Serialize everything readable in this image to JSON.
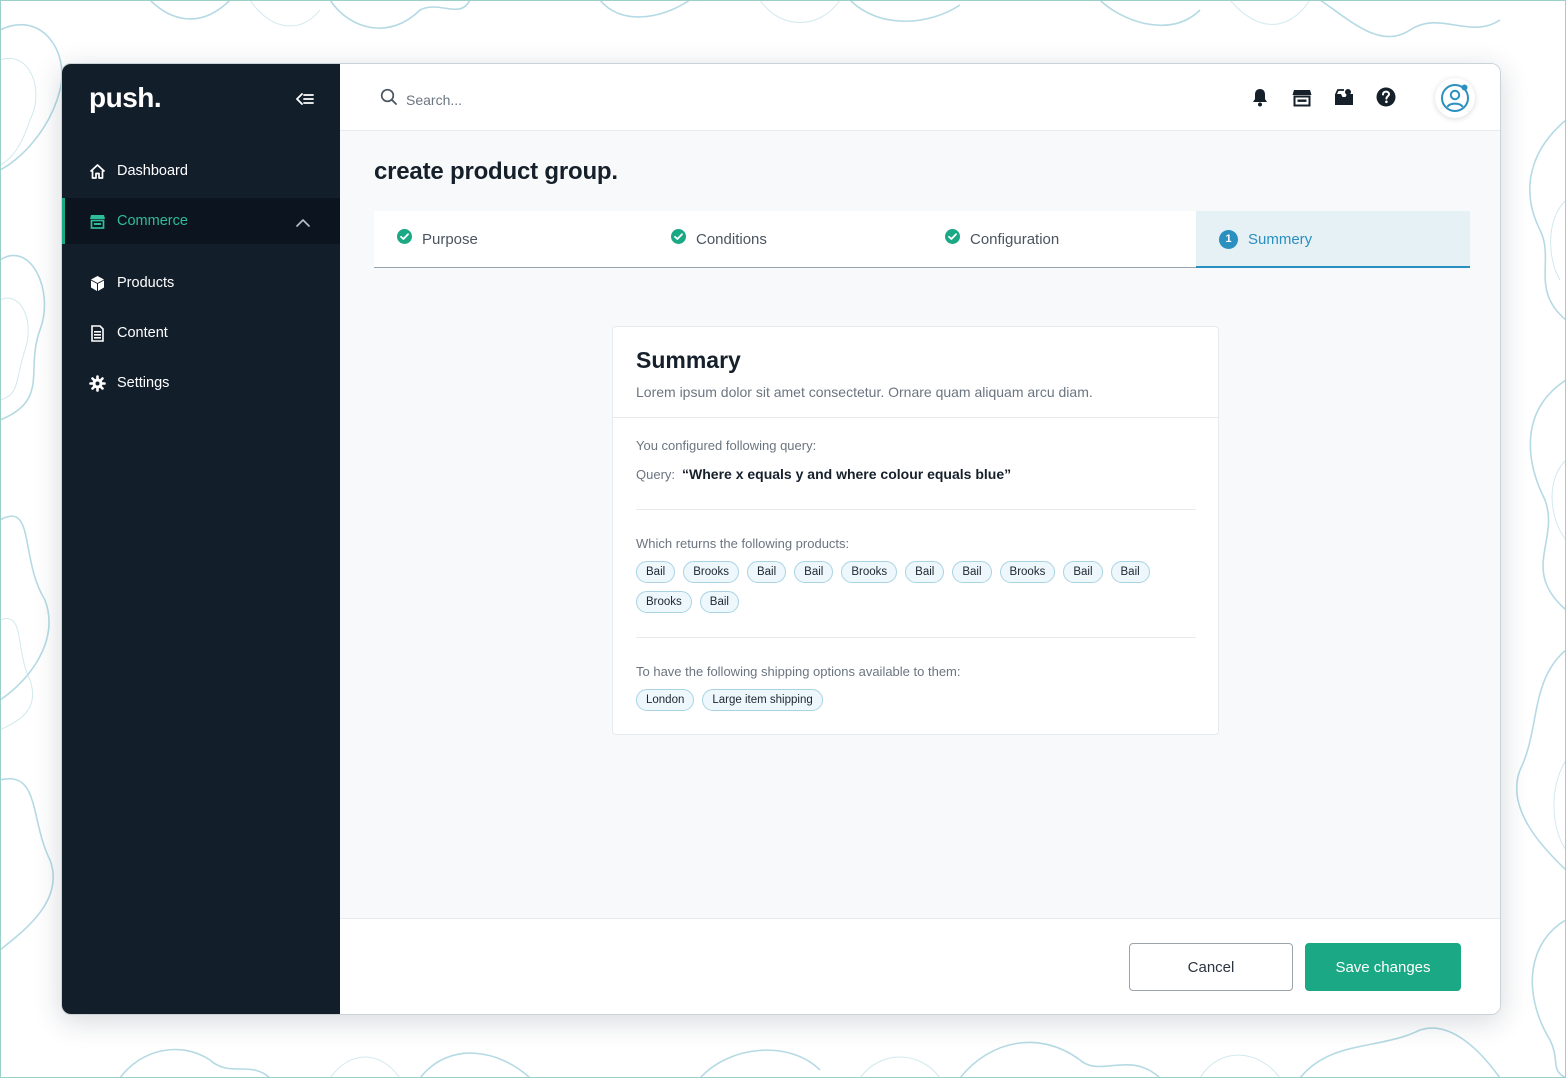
{
  "brand": {
    "logo_text": "push.",
    "accent": "#1ba885",
    "sidebar_bg": "#131e2b",
    "step_accent": "#2b8fbf"
  },
  "sidebar": {
    "collapse_icon": "collapse-sidebar-icon",
    "items": [
      {
        "label": "Dashboard",
        "icon": "home-icon",
        "active": false
      },
      {
        "label": "Commerce",
        "icon": "store-icon",
        "active": true,
        "expanded": true
      },
      {
        "label": "Products",
        "icon": "cube-icon",
        "active": false
      },
      {
        "label": "Content",
        "icon": "document-icon",
        "active": false
      },
      {
        "label": "Settings",
        "icon": "gear-icon",
        "active": false
      }
    ]
  },
  "topbar": {
    "search_placeholder": "Search...",
    "icons": [
      "bell-icon",
      "store-icon",
      "inbox-icon",
      "help-icon",
      "user-avatar-icon"
    ]
  },
  "page": {
    "title": "create product group."
  },
  "steps": [
    {
      "label": "Purpose",
      "status": "complete"
    },
    {
      "label": "Conditions",
      "status": "complete"
    },
    {
      "label": "Configuration",
      "status": "complete"
    },
    {
      "label": "Summery",
      "status": "current",
      "number": "1"
    }
  ],
  "summary": {
    "title": "Summary",
    "subtitle": "Lorem ipsum dolor sit amet consectetur. Ornare quam aliquam arcu diam.",
    "query_intro": "You configured following query:",
    "query_label": "Query:",
    "query_value": "“Where x equals y and where colour equals blue”",
    "products_intro": "Which returns the following products:",
    "products": [
      "Bail",
      "Brooks",
      "Bail",
      "Bail",
      "Brooks",
      "Bail",
      "Bail",
      "Brooks",
      "Bail",
      "Bail",
      "Brooks",
      "Bail"
    ],
    "shipping_intro": "To have the following shipping options available to them:",
    "shipping": [
      "London",
      "Large item shipping"
    ]
  },
  "footer": {
    "cancel_label": "Cancel",
    "save_label": "Save changes"
  }
}
